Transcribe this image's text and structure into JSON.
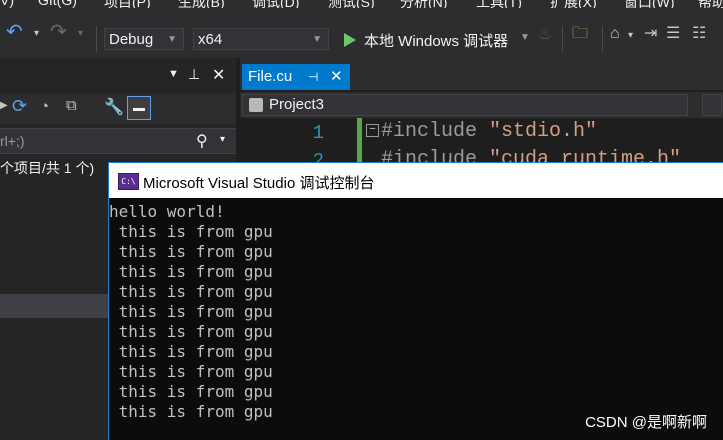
{
  "menu": [
    "V)",
    "GIt(G)",
    "项目(P)",
    "生成(B)",
    "调试(D)",
    "测试(S)",
    "分析(N)",
    "工具(T)",
    "扩展(X)",
    "窗口(W)",
    "帮助(H)"
  ],
  "toolbar": {
    "config": "Debug",
    "platform": "x64",
    "run_label": "本地 Windows 调试器"
  },
  "solution_explorer": {
    "search_text": "rl+;)",
    "status": "个项目/共 1 个)"
  },
  "editor": {
    "tab_name": "File.cu",
    "project": "Project3",
    "lines": [
      {
        "num": "1",
        "code": "#include ",
        "str": "\"stdio.h\""
      },
      {
        "num": "2",
        "code": "#include ",
        "str": "\"cuda_runtime.h\""
      }
    ]
  },
  "console": {
    "title": "Microsoft Visual Studio 调试控制台",
    "icon_text": "C:\\",
    "lines": [
      "hello world!",
      " this is from gpu",
      " this is from gpu",
      " this is from gpu",
      " this is from gpu",
      " this is from gpu",
      " this is from gpu",
      " this is from gpu",
      " this is from gpu",
      " this is from gpu",
      " this is from gpu"
    ]
  },
  "watermark": "CSDN @是啊新啊"
}
